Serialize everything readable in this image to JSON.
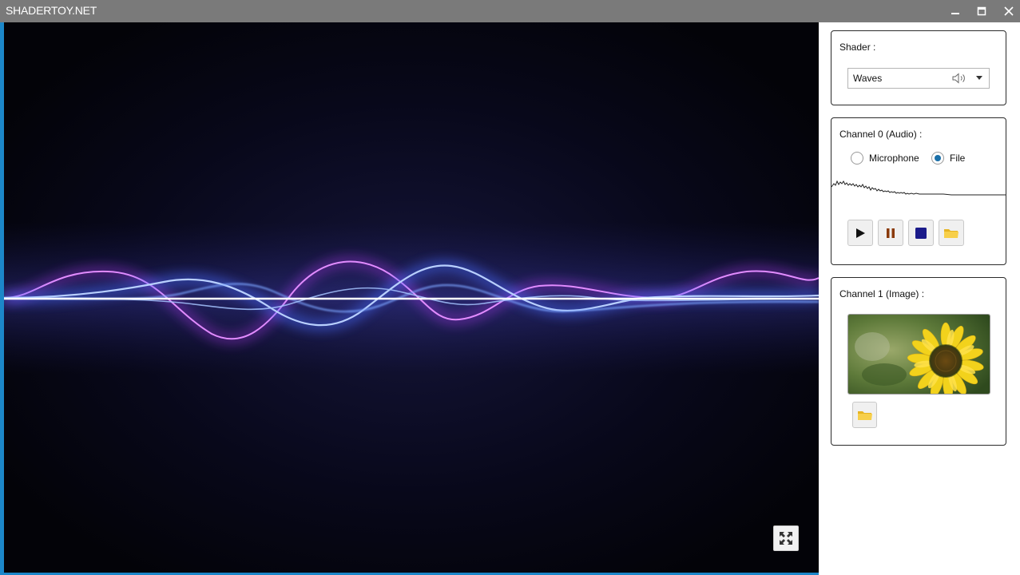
{
  "window": {
    "title": "SHADERTOY.NET"
  },
  "shader": {
    "label": "Shader :",
    "selected": "Waves"
  },
  "channel0": {
    "label": "Channel 0 (Audio) :",
    "options": [
      "Microphone",
      "File"
    ],
    "selected": "File"
  },
  "channel1": {
    "label": "Channel 1 (Image) :"
  },
  "colors": {
    "accent": "#1c87c9",
    "titlebar": "#7a7a7a",
    "radio_selected": "#1a6fa8",
    "pause": "#8a3a0a",
    "stop": "#1b1b8a",
    "folder": "#f4c430"
  },
  "icons": [
    "minimize-icon",
    "maximize-icon",
    "close-icon",
    "speaker-icon",
    "chevron-down-icon",
    "play-icon",
    "pause-icon",
    "stop-icon",
    "folder-icon",
    "fullscreen-icon"
  ]
}
